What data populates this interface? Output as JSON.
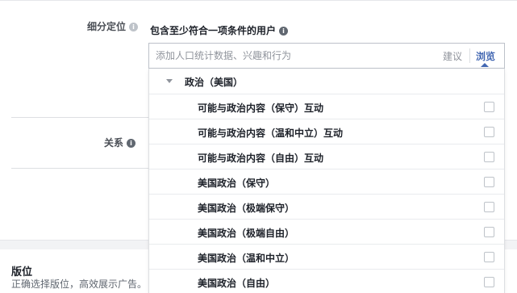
{
  "detailed_targeting": {
    "label": "细分定位",
    "hint": "包含至少符合一项条件的用户",
    "search": {
      "placeholder": "添加人口统计数据、兴趣和行为",
      "suggestions_label": "建议",
      "browse_label": "浏览"
    },
    "info_icon": "i"
  },
  "relationship": {
    "label": "关系",
    "info_icon": "i"
  },
  "dropdown": {
    "category": "政治（美国）",
    "items": [
      {
        "label": "可能与政治内容（保守）互动",
        "checked": false
      },
      {
        "label": "可能与政治内容（温和中立）互动",
        "checked": false
      },
      {
        "label": "可能与政治内容（自由）互动",
        "checked": false
      },
      {
        "label": "美国政治（保守）",
        "checked": false
      },
      {
        "label": "美国政治（极端保守）",
        "checked": false
      },
      {
        "label": "美国政治（极端自由）",
        "checked": false
      },
      {
        "label": "美国政治（温和中立）",
        "checked": false
      },
      {
        "label": "美国政治（自由）",
        "checked": false
      }
    ]
  },
  "placement": {
    "title": "版位",
    "description": "正确选择版位，高效展示广告。"
  }
}
